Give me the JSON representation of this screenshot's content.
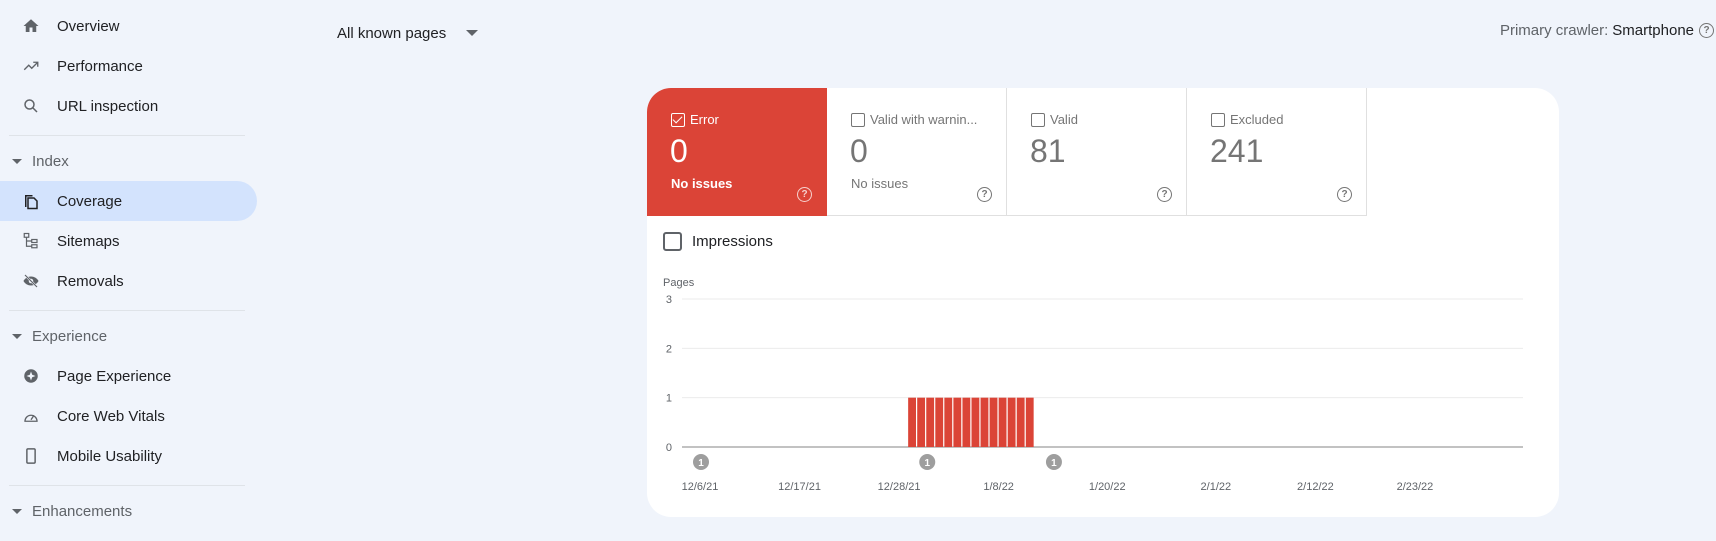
{
  "sidebar": {
    "items": [
      {
        "label": "Overview",
        "icon": "home-icon"
      },
      {
        "label": "Performance",
        "icon": "trending-up-icon"
      },
      {
        "label": "URL inspection",
        "icon": "search-icon"
      }
    ],
    "sections": [
      {
        "label": "Index",
        "items": [
          {
            "label": "Coverage",
            "icon": "coverage-icon",
            "active": true
          },
          {
            "label": "Sitemaps",
            "icon": "sitemap-icon"
          },
          {
            "label": "Removals",
            "icon": "visibility-off-icon"
          }
        ]
      },
      {
        "label": "Experience",
        "items": [
          {
            "label": "Page Experience",
            "icon": "page-experience-icon"
          },
          {
            "label": "Core Web Vitals",
            "icon": "speed-gauge-icon"
          },
          {
            "label": "Mobile Usability",
            "icon": "smartphone-icon"
          }
        ]
      },
      {
        "label": "Enhancements",
        "items": []
      }
    ]
  },
  "topbar": {
    "page_filter": "All known pages",
    "crawler_label": "Primary crawler:",
    "crawler_value": "Smartphone",
    "help_glyph": "?"
  },
  "tiles": [
    {
      "name": "Error",
      "count": "0",
      "sub": "No issues",
      "checked": true,
      "color": "#db4437"
    },
    {
      "name": "Valid with warnin...",
      "count": "0",
      "sub": "No issues",
      "checked": false
    },
    {
      "name": "Valid",
      "count": "81",
      "sub": "",
      "checked": false
    },
    {
      "name": "Excluded",
      "count": "241",
      "sub": "",
      "checked": false
    }
  ],
  "impressions_label": "Impressions",
  "chart_data": {
    "type": "bar",
    "title": "",
    "ylabel": "Pages",
    "xlabel": "",
    "ylim": [
      0,
      3
    ],
    "yticks": [
      0,
      1,
      2,
      3
    ],
    "grid": true,
    "x_start": "2021-12-06",
    "x_end": "2022-03-02",
    "xtick_labels": [
      "12/6/21",
      "12/17/21",
      "12/28/21",
      "1/8/22",
      "1/20/22",
      "2/1/22",
      "2/12/22",
      "2/23/22"
    ],
    "xtick_dates": [
      "2021-12-06",
      "2021-12-17",
      "2021-12-28",
      "2022-01-08",
      "2022-01-20",
      "2022-02-01",
      "2022-02-12",
      "2022-02-23"
    ],
    "series": [
      {
        "name": "Error",
        "color": "#db4437",
        "points": [
          {
            "date": "2021-12-29",
            "value": 1
          },
          {
            "date": "2021-12-30",
            "value": 1
          },
          {
            "date": "2021-12-31",
            "value": 1
          },
          {
            "date": "2022-01-01",
            "value": 1
          },
          {
            "date": "2022-01-02",
            "value": 1
          },
          {
            "date": "2022-01-03",
            "value": 1
          },
          {
            "date": "2022-01-04",
            "value": 1
          },
          {
            "date": "2022-01-05",
            "value": 1
          },
          {
            "date": "2022-01-06",
            "value": 1
          },
          {
            "date": "2022-01-07",
            "value": 1
          },
          {
            "date": "2022-01-08",
            "value": 1
          },
          {
            "date": "2022-01-09",
            "value": 1
          },
          {
            "date": "2022-01-10",
            "value": 1
          },
          {
            "date": "2022-01-11",
            "value": 1
          }
        ]
      }
    ],
    "annotations": [
      {
        "date": "2021-12-06",
        "label": "1"
      },
      {
        "date": "2021-12-31",
        "label": "1"
      },
      {
        "date": "2022-01-14",
        "label": "1"
      }
    ]
  }
}
